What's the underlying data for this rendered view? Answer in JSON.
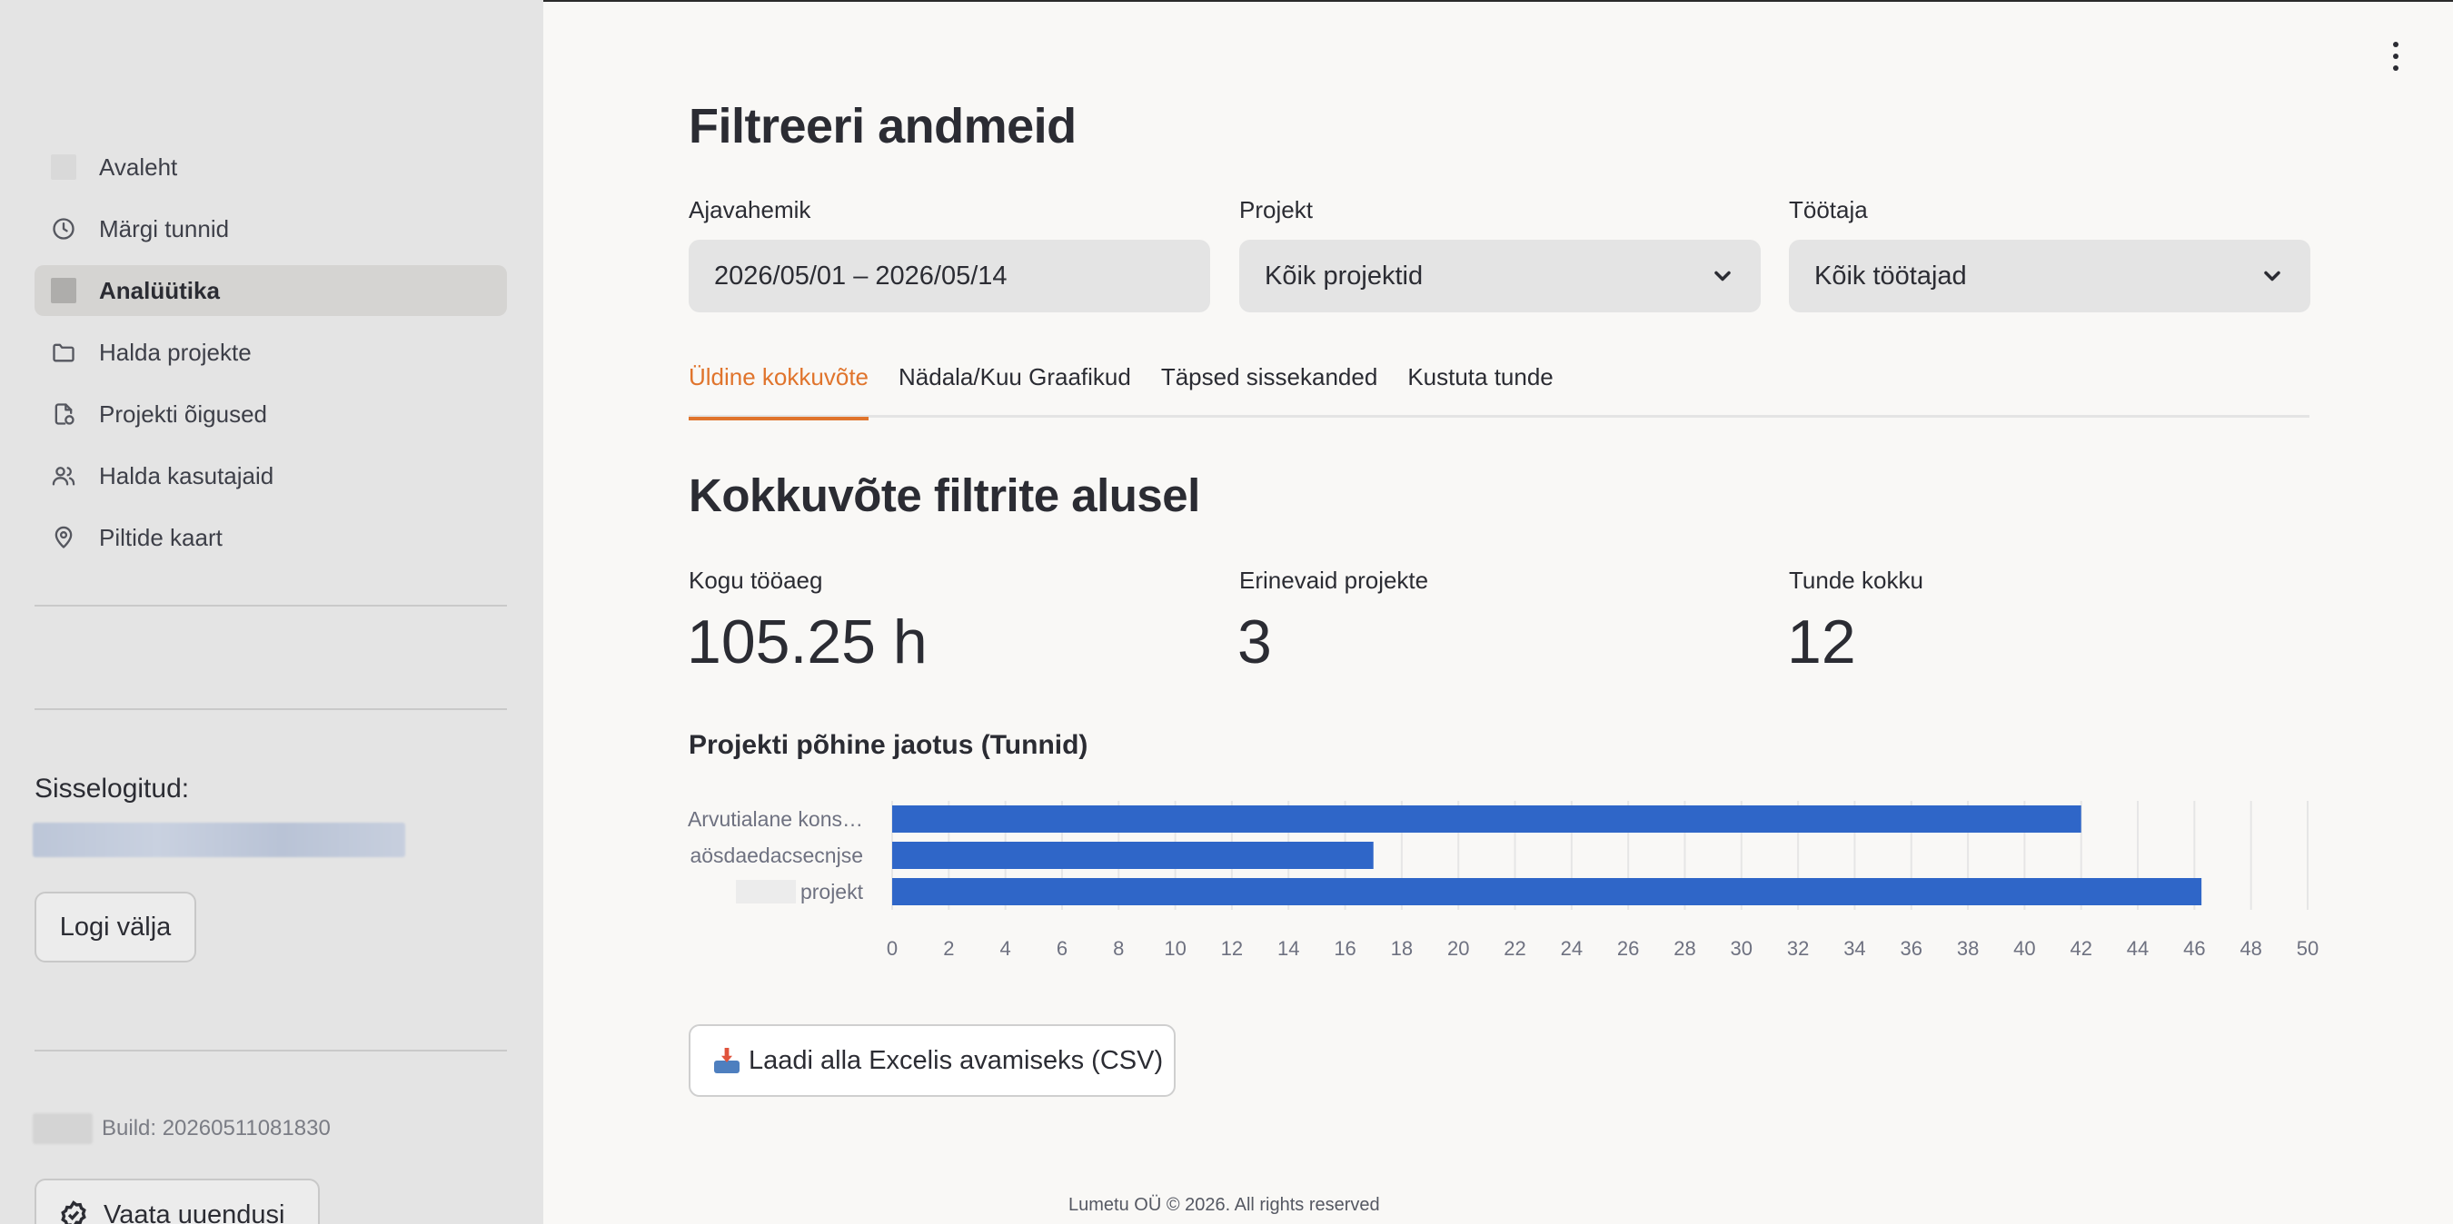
{
  "sidebar": {
    "items": [
      {
        "label": "Avaleht",
        "icon": "placeholder-icon"
      },
      {
        "label": "Märgi tunnid",
        "icon": "clock-icon"
      },
      {
        "label": "Analüütika",
        "icon": "placeholder-icon",
        "active": true
      },
      {
        "label": "Halda projekte",
        "icon": "folder-icon"
      },
      {
        "label": "Projekti õigused",
        "icon": "file-shield-icon"
      },
      {
        "label": "Halda kasutajaid",
        "icon": "users-icon"
      },
      {
        "label": "Piltide kaart",
        "icon": "map-pin-icon"
      }
    ],
    "signed_in_label": "Sisselogitud:",
    "logout_label": "Logi välja",
    "build_text": "Build: 20260511081830",
    "updates_label": "Vaata uuendusi"
  },
  "main": {
    "title": "Filtreeri andmeid",
    "filters": {
      "date": {
        "label": "Ajavahemik",
        "value": "2026/05/01 – 2026/05/14"
      },
      "project": {
        "label": "Projekt",
        "value": "Kõik projektid"
      },
      "employee": {
        "label": "Töötaja",
        "value": "Kõik töötajad"
      }
    },
    "tabs": [
      {
        "label": "Üldine kokkuvõte",
        "active": true
      },
      {
        "label": "Nädala/Kuu Graafikud"
      },
      {
        "label": "Täpsed sissekanded"
      },
      {
        "label": "Kustuta tunde"
      }
    ],
    "section_title": "Kokkuvõte filtrite alusel",
    "metrics": [
      {
        "label": "Kogu tööaeg",
        "value": "105.25 h"
      },
      {
        "label": "Erinevaid projekte",
        "value": "3"
      },
      {
        "label": "Tunde kokku",
        "value": "12"
      }
    ],
    "chart_title": "Projekti põhine jaotus (Tunnid)",
    "download_label": "Laadi alla Excelis avamiseks (CSV)",
    "footer": "Lumetu OÜ © 2026. All rights reserved"
  },
  "colors": {
    "accent": "#e0742c",
    "bar": "#2f66c8",
    "sidebar_bg": "#e4e4e4",
    "page_bg": "#f9f8f6"
  },
  "chart_data": {
    "type": "bar",
    "orientation": "horizontal",
    "title": "Projekti põhine jaotus (Tunnid)",
    "categories": [
      "Arvutialane kons…",
      "aösdaedacsecnjse",
      "projekt"
    ],
    "values": [
      42,
      17,
      46.25
    ],
    "xlim": [
      0,
      50
    ],
    "xticks": [
      0,
      2,
      4,
      6,
      8,
      10,
      12,
      14,
      16,
      18,
      20,
      22,
      24,
      26,
      28,
      30,
      32,
      34,
      36,
      38,
      40,
      42,
      44,
      46,
      48,
      50
    ],
    "grid": true,
    "legend": "none"
  }
}
